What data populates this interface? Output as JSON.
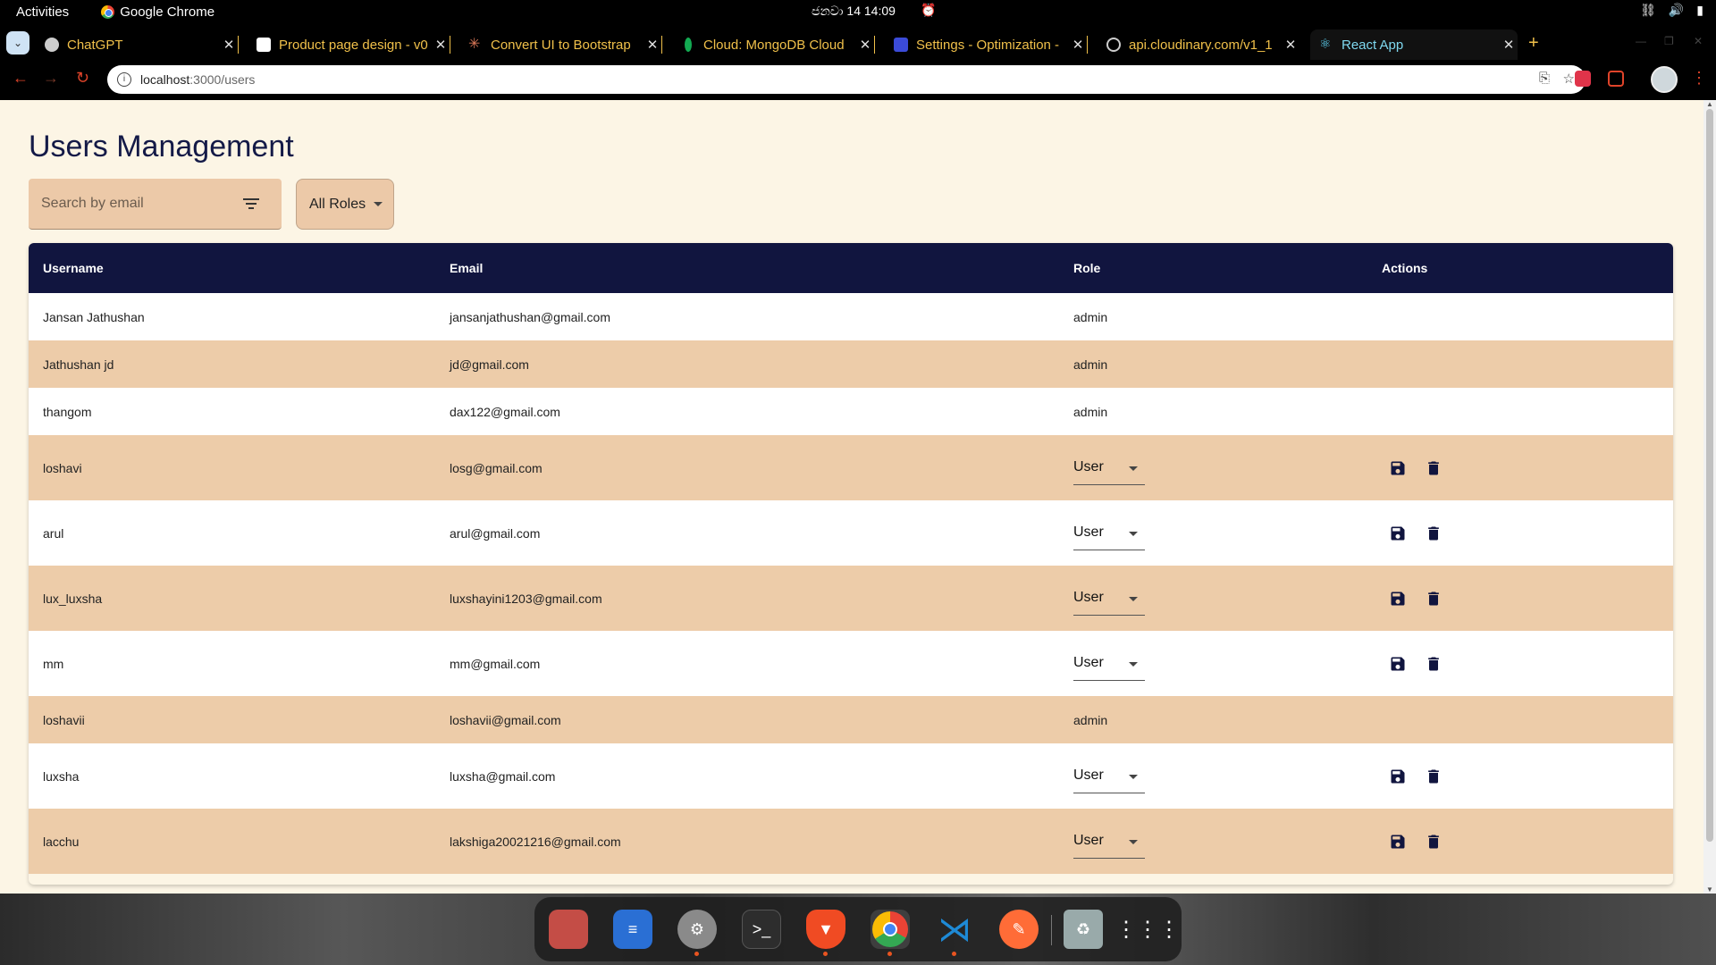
{
  "system": {
    "activities": "Activities",
    "app_name": "Google Chrome",
    "clock": "ජනවා 14  14:09",
    "tray_icons": [
      "network-icon",
      "volume-icon",
      "battery-icon"
    ]
  },
  "browser": {
    "tabs": [
      {
        "title": "ChatGPT",
        "icon": "chatgpt-icon",
        "active": false
      },
      {
        "title": "Product page design - v0",
        "icon": "v0-icon",
        "active": false
      },
      {
        "title": "Convert UI to Bootstrap",
        "icon": "claude-icon",
        "active": false
      },
      {
        "title": "Cloud: MongoDB Cloud",
        "icon": "mongodb-icon",
        "active": false
      },
      {
        "title": "Settings - Optimization -",
        "icon": "settings-site-icon",
        "active": false
      },
      {
        "title": "api.cloudinary.com/v1_1",
        "icon": "globe-icon",
        "active": false
      },
      {
        "title": "React App",
        "icon": "react-icon",
        "active": true
      }
    ],
    "url_host": "localhost",
    "url_path": ":3000/users"
  },
  "page": {
    "title": "Users Management",
    "search_placeholder": "Search by email",
    "role_filter": "All Roles",
    "columns": {
      "username": "Username",
      "email": "Email",
      "role": "Role",
      "actions": "Actions"
    },
    "users": [
      {
        "username": "Jansan Jathushan",
        "email": "jansanjathushan@gmail.com",
        "role": "admin",
        "editable": false
      },
      {
        "username": "Jathushan jd",
        "email": "jd@gmail.com",
        "role": "admin",
        "editable": false
      },
      {
        "username": "thangom",
        "email": "dax122@gmail.com",
        "role": "admin",
        "editable": false
      },
      {
        "username": "loshavi",
        "email": "losg@gmail.com",
        "role": "User",
        "editable": true
      },
      {
        "username": "arul",
        "email": "arul@gmail.com",
        "role": "User",
        "editable": true
      },
      {
        "username": "lux_luxsha",
        "email": "luxshayini1203@gmail.com",
        "role": "User",
        "editable": true
      },
      {
        "username": "mm",
        "email": "mm@gmail.com",
        "role": "User",
        "editable": true
      },
      {
        "username": "loshavii",
        "email": "loshavii@gmail.com",
        "role": "admin",
        "editable": false
      },
      {
        "username": "luxsha",
        "email": "luxsha@gmail.com",
        "role": "User",
        "editable": true
      },
      {
        "username": "lacchu",
        "email": "lakshiga20021216@gmail.com",
        "role": "User",
        "editable": true
      }
    ]
  },
  "colors": {
    "header_bg": "#11153f",
    "row_alt": "#edcca9",
    "page_bg": "#fcf5e5",
    "accent": "#141a47"
  },
  "dock": {
    "apps": [
      "files-icon",
      "text-editor-icon",
      "settings-icon",
      "terminal-icon",
      "brave-icon",
      "chrome-icon",
      "vscode-icon",
      "postman-icon",
      "trash-icon",
      "app-grid-icon"
    ]
  }
}
